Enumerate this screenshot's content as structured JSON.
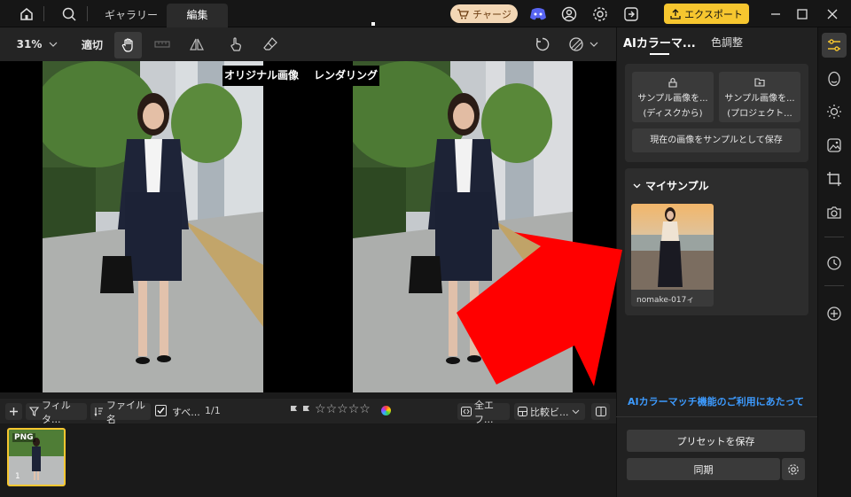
{
  "tabs": {
    "gallery": "ギャラリー",
    "edit": "編集"
  },
  "header": {
    "charge_label": "チャージ",
    "export_label": "エクスポート"
  },
  "toolbar": {
    "zoom": "31%",
    "fit": "適切"
  },
  "canvas": {
    "original_label": "オリジナル画像",
    "render_label": "レンダリング"
  },
  "filter_bar": {
    "filter_label": "フィルタ...",
    "sort_label": "ファイル名",
    "select_all_label": "すべ...",
    "count": "1/1",
    "stars": [
      "☆",
      "☆",
      "☆",
      "☆",
      "☆"
    ],
    "view_label": "全エフ...",
    "compare_label": "比較ビ..."
  },
  "filmstrip": {
    "items": [
      {
        "badge": "PNG",
        "index": "1"
      }
    ]
  },
  "panel": {
    "tab_ai": "AIカラーマ...",
    "tab_color": "色調整",
    "sample_disk_line1": "サンプル画像を...",
    "sample_disk_line2": "(ディスクから)",
    "sample_project_line1": "サンプル画像を...",
    "sample_project_line2": "(プロジェクト...",
    "save_current": "現在の画像をサンプルとして保存",
    "my_samples": "マイサンプル",
    "sample_name": "nomake-017ィ",
    "info_link": "AIカラーマッチ機能のご利用にあたって",
    "save_preset": "プリセットを保存",
    "sync": "同期"
  },
  "colors": {
    "accent": "#f6c62f",
    "link": "#3d9bff",
    "arrow": "#ff0000"
  }
}
